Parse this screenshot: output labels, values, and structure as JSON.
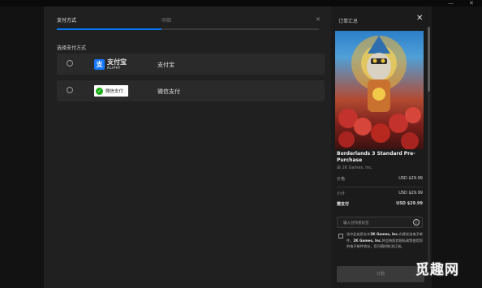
{
  "window": {
    "close_glyph": "✕",
    "minimize_glyph": "—"
  },
  "checkout": {
    "steps": {
      "active": "支付方式",
      "next": "明细"
    },
    "progress": 0.4,
    "close_glyph": "✕",
    "payment_heading": "选择支付方式",
    "methods": [
      {
        "label": "支付宝",
        "logo_cn": "支付宝",
        "logo_en": "ALIPAY",
        "logo_mark": "支",
        "icon": "alipay-logo"
      },
      {
        "label": "微信支付",
        "logo_text": "微信支付",
        "icon": "wechat-pay-logo"
      }
    ]
  },
  "summary": {
    "title": "订单汇总",
    "close_glyph": "✕",
    "game_title": "Borderlands 3 Standard Pre-Purchase",
    "publisher": "由 2K Games, Inc.",
    "rows": [
      {
        "label": "价格",
        "value": "USD $29.99"
      },
      {
        "label": "小计",
        "value": "USD $29.99"
      },
      {
        "label": "需支付",
        "value": "USD $29.99"
      }
    ],
    "creator_placeholder": "输入创作者标签",
    "info_glyph": "i",
    "agree_pre": "选中此处即允许",
    "agree_company_1": "2K Games, Inc.",
    "agree_mid_1": "向我发送电子邮件。",
    "agree_company_2": "2K Games, Inc.",
    "agree_rest": "将会按照其隐私政策使用您的电子邮件地址，您可随时取消订阅。",
    "order_button": "订购"
  },
  "watermark": "觅趣网"
}
